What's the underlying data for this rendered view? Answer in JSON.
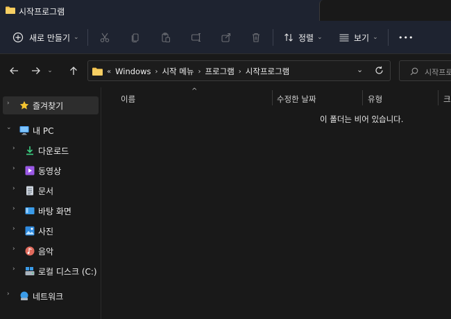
{
  "window": {
    "title": "시작프로그램"
  },
  "toolbar": {
    "new_label": "새로 만들기",
    "sort_label": "정렬",
    "view_label": "보기",
    "more_label": "•••",
    "icons": [
      "cut-icon",
      "copy-icon",
      "paste-icon",
      "rename-icon",
      "share-icon",
      "delete-icon"
    ]
  },
  "address": {
    "overflow": "«",
    "crumbs": [
      "Windows",
      "시작 메뉴",
      "프로그램",
      "시작프로그램"
    ],
    "sep": "›"
  },
  "search": {
    "placeholder": "시작프로"
  },
  "sidebar": {
    "items": [
      {
        "label": "즐겨찾기",
        "icon": "star-icon"
      },
      {
        "label": "내 PC",
        "icon": "pc-icon"
      },
      {
        "label": "다운로드",
        "icon": "download-icon"
      },
      {
        "label": "동영상",
        "icon": "video-icon"
      },
      {
        "label": "문서",
        "icon": "document-icon"
      },
      {
        "label": "바탕 화면",
        "icon": "desktop-icon"
      },
      {
        "label": "사진",
        "icon": "pictures-icon"
      },
      {
        "label": "음악",
        "icon": "music-icon"
      },
      {
        "label": "로컬 디스크 (C:)",
        "icon": "disk-icon"
      },
      {
        "label": "네트워크",
        "icon": "network-icon"
      }
    ]
  },
  "columns": {
    "name": "이름",
    "modified": "수정한 날짜",
    "type": "유형",
    "size": "크"
  },
  "content": {
    "empty_message": "이 폴더는 비어 있습니다."
  },
  "colors": {
    "titlebar": "#1e2330",
    "background": "#191919",
    "folder": "#f2c14e",
    "accent_blue": "#4aa3ff"
  }
}
